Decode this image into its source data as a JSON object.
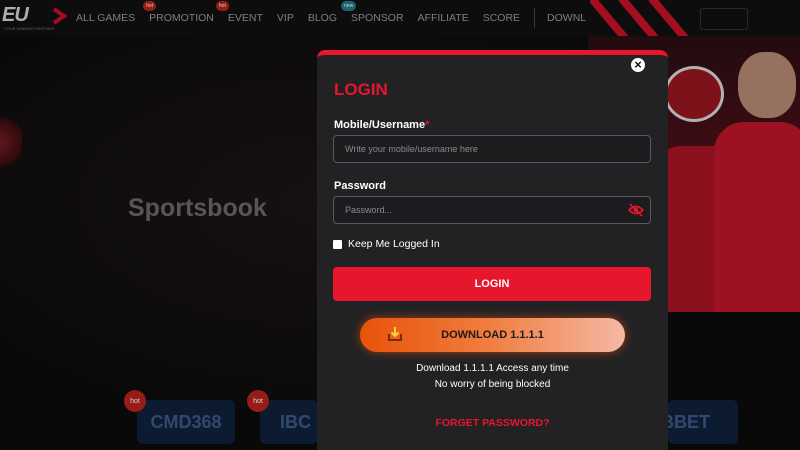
{
  "logo": {
    "text": "EU",
    "tagline": "YOUR WINNING PARTNER"
  },
  "nav": {
    "items": [
      {
        "label": "ALL GAMES",
        "badge": ""
      },
      {
        "label": "PROMOTION",
        "badge": "hot"
      },
      {
        "label": "EVENT",
        "badge": "hot"
      },
      {
        "label": "VIP",
        "badge": ""
      },
      {
        "label": "BLOG",
        "badge": ""
      },
      {
        "label": "SPONSOR",
        "badge": "new"
      },
      {
        "label": "AFFILIATE",
        "badge": ""
      },
      {
        "label": "SCORE",
        "badge": ""
      }
    ],
    "download_label": "DOWNL"
  },
  "background": {
    "section_title": "Sportsbook",
    "providers": [
      {
        "label": "CMD368",
        "badge": "hot"
      },
      {
        "label": "IBC",
        "badge": "hot"
      },
      {
        "label": "BBET",
        "badge": ""
      }
    ]
  },
  "modal": {
    "title": "LOGIN",
    "username": {
      "label": "Mobile/Username",
      "required_mark": "*",
      "placeholder": "Write your mobile/username here"
    },
    "password": {
      "label": "Password",
      "placeholder": "Password..."
    },
    "remember_label": "Keep Me Logged In",
    "login_button": "LOGIN",
    "download_button": "DOWNLOAD 1.1.1.1",
    "download_line1": "Download 1.1.1.1 Access any time",
    "download_line2": "No worry of being blocked",
    "forgot_link": "FORGET PASSWORD?"
  },
  "colors": {
    "accent": "#e8162c",
    "modal_bg": "#222225",
    "download_gradient_start": "#e8530a"
  },
  "icons": {
    "close": "close-icon",
    "eye": "eye-slash-icon",
    "download": "download-icon"
  }
}
